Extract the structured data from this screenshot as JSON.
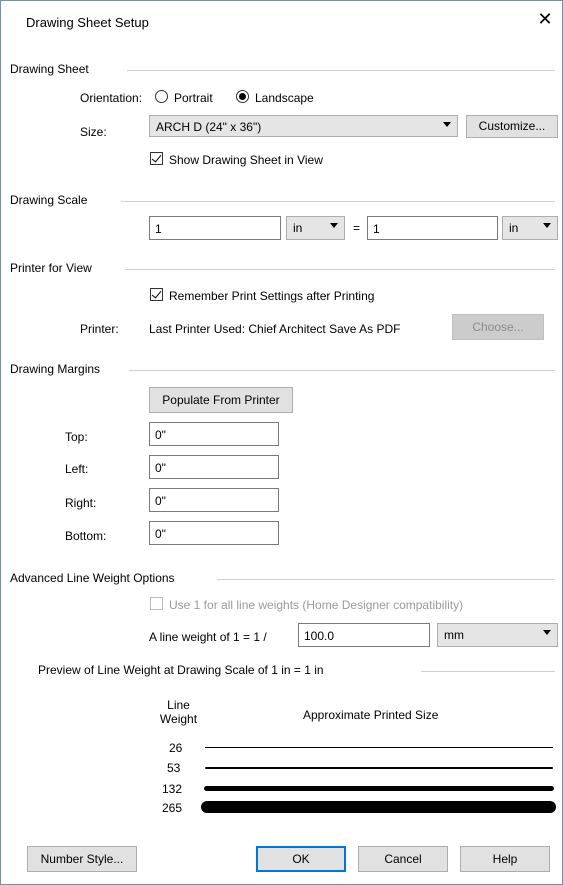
{
  "dialog": {
    "title": "Drawing Sheet Setup",
    "close_glyph": "✕"
  },
  "drawing_sheet": {
    "group_label": "Drawing Sheet",
    "orientation_label": "Orientation:",
    "portrait_label": "Portrait",
    "landscape_label": "Landscape",
    "selected_orientation": "Landscape",
    "size_label": "Size:",
    "size_value": "ARCH D  (24\" x 36\")",
    "customize_label": "Customize...",
    "show_sheet_label": "Show Drawing Sheet in View",
    "show_sheet_checked": true
  },
  "drawing_scale": {
    "group_label": "Drawing Scale",
    "left_value": "1",
    "left_unit": "in",
    "equals": "=",
    "right_value": "1",
    "right_unit": "in"
  },
  "printer": {
    "group_label": "Printer for View",
    "remember_label": "Remember Print Settings after Printing",
    "remember_checked": true,
    "printer_label": "Printer:",
    "printer_value": "Last Printer Used:  Chief Architect Save As PDF",
    "choose_label": "Choose..."
  },
  "margins": {
    "group_label": "Drawing Margins",
    "populate_label": "Populate From Printer",
    "top_label": "Top:",
    "top_value": "0\"",
    "left_label": "Left:",
    "left_value": "0\"",
    "right_label": "Right:",
    "right_value": "0\"",
    "bottom_label": "Bottom:",
    "bottom_value": "0\""
  },
  "line_weight": {
    "group_label": "Advanced Line Weight Options",
    "use1_label": "Use 1 for all line weights (Home Designer compatibility)",
    "use1_checked": false,
    "lw_label": "A line weight of 1 = 1 /",
    "lw_value": "100.0",
    "lw_unit": "mm",
    "preview_label": "Preview of Line Weight at Drawing Scale of  1 in = 1 in",
    "col_line_weight_1": "Line",
    "col_line_weight_2": "Weight",
    "col_printed": "Approximate Printed Size",
    "rows": [
      {
        "weight": "26"
      },
      {
        "weight": "53"
      },
      {
        "weight": "132"
      },
      {
        "weight": "265"
      }
    ]
  },
  "footer": {
    "number_style_label": "Number Style...",
    "ok_label": "OK",
    "cancel_label": "Cancel",
    "help_label": "Help"
  }
}
